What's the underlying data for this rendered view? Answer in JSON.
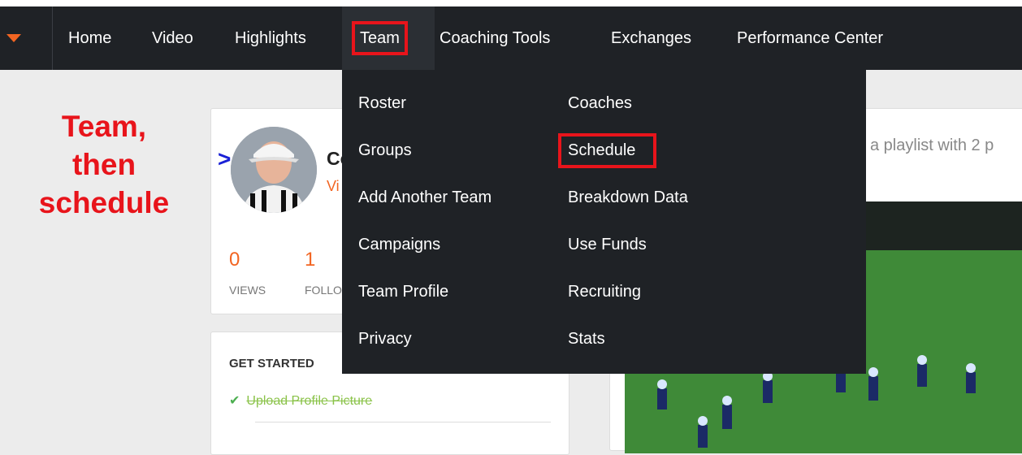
{
  "nav": {
    "items": [
      {
        "label": "Home"
      },
      {
        "label": "Video"
      },
      {
        "label": "Highlights"
      },
      {
        "label": "Team"
      },
      {
        "label": "Coaching Tools"
      },
      {
        "label": "Exchanges"
      },
      {
        "label": "Performance Center"
      }
    ]
  },
  "annotation": {
    "lines": [
      "Team,",
      "then",
      "schedule"
    ]
  },
  "profile": {
    "name": "Co",
    "view_link": "Vi",
    "stats": [
      {
        "value": "0",
        "label": "VIEWS"
      },
      {
        "value": "1",
        "label": "FOLLO"
      }
    ]
  },
  "get_started": {
    "title": "GET STARTED",
    "items": [
      "Upload Profile Picture"
    ]
  },
  "feed": {
    "text": "a playlist with 2 p"
  },
  "dropdown": {
    "left": [
      "Roster",
      "Groups",
      "Add Another Team",
      "Campaigns",
      "Team Profile",
      "Privacy"
    ],
    "right": [
      "Coaches",
      "Schedule",
      "Breakdown Data",
      "Use Funds",
      "Recruiting",
      "Stats"
    ]
  },
  "colors": {
    "accent": "#f26522",
    "highlight_box": "#e8141b",
    "nav_bg": "#1f2226"
  }
}
